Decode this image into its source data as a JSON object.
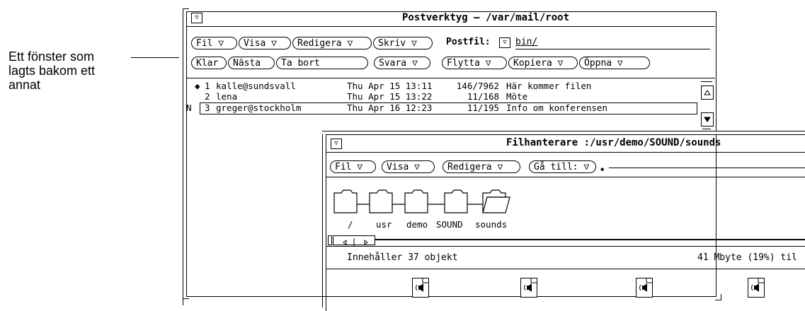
{
  "callout": {
    "lines": [
      "Ett fönster som",
      "lagts bakom ett",
      "annat"
    ]
  },
  "mail_window": {
    "title": "Postverktyg – /var/mail/root",
    "menu_glyph": "▽",
    "buttons_row1": [
      "Fil ▽",
      "Visa ▽",
      "Redigera ▽",
      "Skriv ▽"
    ],
    "postfil_label": "Postfil:",
    "postfil_glyph": "▽",
    "postfil_value": "bin/",
    "buttons_row2": [
      "Klar",
      "Nästa",
      "Ta bort",
      "Svara ▽",
      "Flytta ▽",
      "Kopiera ▽",
      "Öppna ▽"
    ],
    "messages": [
      {
        "flag": "",
        "marker": "◆",
        "num": "1",
        "from": "kalle@sundsvall",
        "date": "Thu Apr 15 13:11",
        "size": "146/7962",
        "subject": "Här kommer filen"
      },
      {
        "flag": "",
        "marker": "",
        "num": "2",
        "from": "lena",
        "date": "Thu Apr 15 13:22",
        "size": "11/168",
        "subject": "Möte"
      },
      {
        "flag": "N",
        "marker": "",
        "num": "3",
        "from": "greger@stockholm",
        "date": "Thu Apr 16 12:23",
        "size": "11/195",
        "subject": "Info om konferensen"
      }
    ]
  },
  "file_window": {
    "title": "Filhanterare :/usr/demo/SOUND/sounds",
    "menu_glyph": "▽",
    "buttons": [
      "Fil ▽",
      "Visa ▽",
      "Redigera ▽",
      "Gå till: ▽"
    ],
    "path_folders": [
      "/",
      "usr",
      "demo",
      "SOUND",
      "sounds"
    ],
    "status_left": "Innehåller 37 objekt",
    "status_right": "41 Mbyte (19%) til"
  }
}
